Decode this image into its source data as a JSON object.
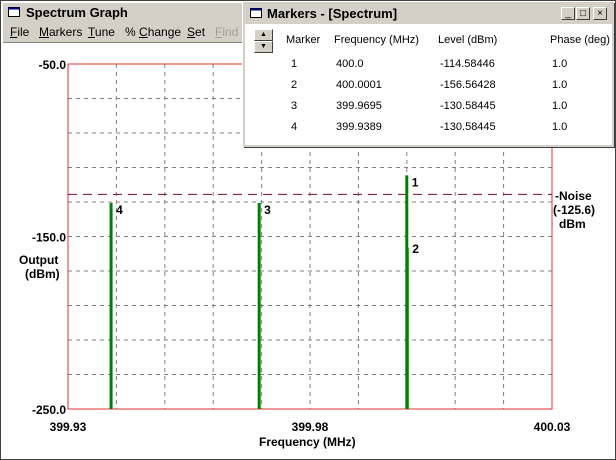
{
  "main_window": {
    "title": "Spectrum Graph",
    "menu": [
      {
        "label": "File",
        "accel": "F",
        "rest": "ile",
        "enabled": true
      },
      {
        "label": "Markers",
        "accel": "M",
        "rest": "arkers",
        "enabled": true
      },
      {
        "label": "Tune",
        "accel": "T",
        "rest": "une",
        "enabled": true
      },
      {
        "label": "% Change",
        "accel": "C",
        "pre": "% ",
        "rest": "hange",
        "enabled": true
      },
      {
        "label": "Set",
        "accel": "S",
        "rest": "et",
        "enabled": true
      },
      {
        "label": "Find",
        "accel": "F",
        "rest": "ind",
        "enabled": false
      }
    ]
  },
  "marker_window": {
    "title": "Markers - [Spectrum]",
    "buttons": {
      "minimize": "_",
      "maximize": "□",
      "close": "×"
    },
    "columns": [
      "Marker",
      "Frequency (MHz)",
      "Level (dBm)",
      "Phase (deg)"
    ],
    "rows": [
      {
        "marker": "1",
        "frequency": "400.0",
        "level": "-114.58446",
        "phase": "1.0"
      },
      {
        "marker": "2",
        "frequency": "400.0001",
        "level": "-156.56428",
        "phase": "1.0"
      },
      {
        "marker": "3",
        "frequency": "399.9695",
        "level": "-130.58445",
        "phase": "1.0"
      },
      {
        "marker": "4",
        "frequency": "399.9389",
        "level": "-130.58445",
        "phase": "1.0"
      }
    ]
  },
  "chart_data": {
    "type": "line",
    "xlabel": "Frequency (MHz)",
    "ylabel": "Output (dBm)",
    "xlim": [
      399.93,
      400.03
    ],
    "ylim": [
      -250.0,
      -50.0
    ],
    "x_ticks": [
      "399.93",
      "399.98",
      "400.03"
    ],
    "y_ticks": [
      "-50.0",
      "-150.0",
      "-250.0"
    ],
    "grid": true,
    "colors": {
      "axes": "#e03030",
      "grid": "#808080",
      "signal": "#008000",
      "noise": "#800040"
    },
    "noise_floor": {
      "label": "-Noise",
      "value_label": "(-125.6)",
      "unit": "dBm",
      "value": -125.6
    },
    "spectral_lines": [
      {
        "marker": "1",
        "frequency": 400.0,
        "level": -114.58446
      },
      {
        "marker": "2",
        "frequency": 400.0001,
        "level": -156.56428
      },
      {
        "marker": "3",
        "frequency": 399.9695,
        "level": -130.58445
      },
      {
        "marker": "4",
        "frequency": 399.9389,
        "level": -130.58445
      }
    ]
  }
}
